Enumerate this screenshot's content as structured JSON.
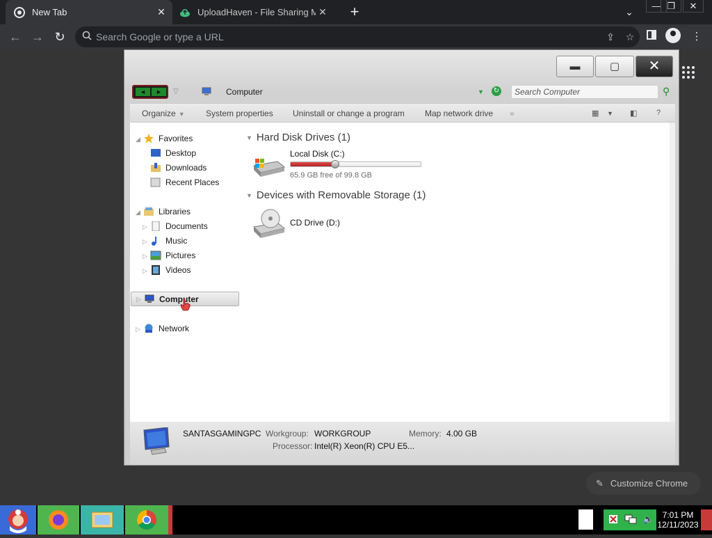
{
  "browser": {
    "tabs": [
      {
        "title": "New Tab",
        "active": true
      },
      {
        "title": "UploadHaven - File Sharing Made",
        "active": false
      }
    ],
    "new_tab": "+",
    "omnibox_placeholder": "Search Google or type a URL",
    "customize_label": "Customize Chrome",
    "window_controls": {
      "minimize": "—",
      "maximize": "❐",
      "close": "✕"
    },
    "colors": {
      "frame": "#202124",
      "toolbar": "#35363a",
      "page": "#353535"
    }
  },
  "explorer": {
    "address": "Computer",
    "search_placeholder": "Search Computer",
    "commands": [
      "Organize",
      "System properties",
      "Uninstall or change a program",
      "Map network drive"
    ],
    "overflow": "»",
    "help": "?",
    "nav": {
      "favorites_header": "Favorites",
      "favorites": [
        "Desktop",
        "Downloads",
        "Recent Places"
      ],
      "libraries_header": "Libraries",
      "libraries": [
        "Documents",
        "Music",
        "Pictures",
        "Videos"
      ],
      "computer": "Computer",
      "network": "Network"
    },
    "groups": {
      "hdd_title": "Hard Disk Drives (1)",
      "removable_title": "Devices with Removable Storage (1)"
    },
    "local_disk": {
      "name": "Local Disk (C:)",
      "free_text": "65.9 GB free of 99.8 GB",
      "used_fraction": 0.34
    },
    "cd_drive": {
      "name": "CD Drive (D:)"
    },
    "details": {
      "computer_name": "SANTASGAMINGPC",
      "workgroup_label": "Workgroup:",
      "workgroup_value": "WORKGROUP",
      "memory_label": "Memory:",
      "memory_value": "4.00 GB",
      "processor_label": "Processor:",
      "processor_value": "Intel(R) Xeon(R) CPU E5..."
    }
  },
  "taskbar": {
    "clock_time": "7:01 PM",
    "clock_date": "12/11/2023"
  }
}
